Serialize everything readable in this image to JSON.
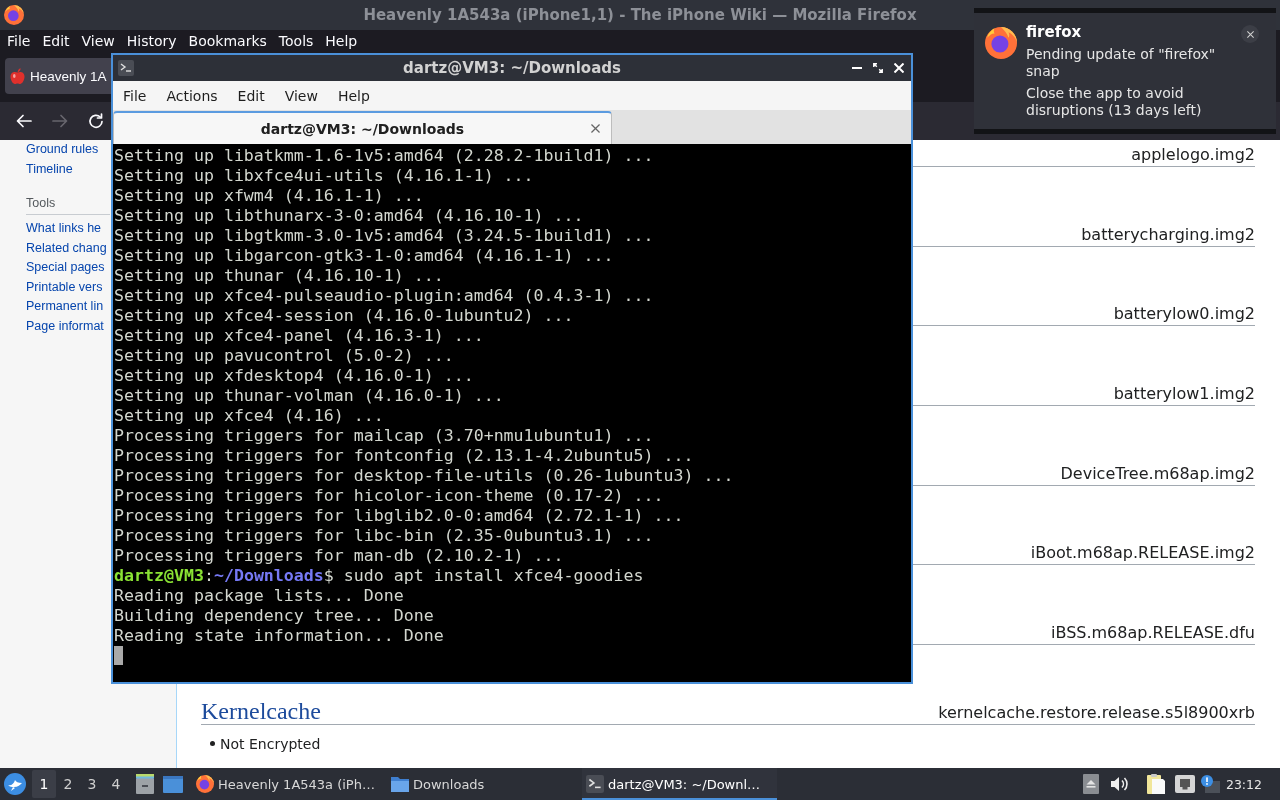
{
  "browser": {
    "title": "Heavenly 1A543a (iPhone1,1) - The iPhone Wiki — Mozilla Firefox",
    "menu": [
      "File",
      "Edit",
      "View",
      "History",
      "Bookmarks",
      "Tools",
      "Help"
    ],
    "tabs": [
      {
        "label": "Heavenly 1A",
        "selected": true
      }
    ],
    "nav_buttons": [
      {
        "kind": "back",
        "disabled": false
      },
      {
        "kind": "forward",
        "disabled": true
      },
      {
        "kind": "reload",
        "disabled": false
      }
    ],
    "sidebar": {
      "links": [
        "Ground rules",
        "Timeline"
      ],
      "portlets": [
        {
          "heading": "Tools",
          "links": [
            "What links he",
            "Related chang",
            "Special pages",
            "Printable vers",
            "Permanent lin",
            "Page informat"
          ]
        }
      ]
    },
    "sections": [
      {
        "file": "applelogo.img2"
      },
      {
        "file": "batterycharging.img2"
      },
      {
        "file": "batterylow0.img2"
      },
      {
        "file": "batterylow1.img2"
      },
      {
        "file": "DeviceTree.m68ap.img2"
      },
      {
        "file": "iBoot.m68ap.RELEASE.img2"
      },
      {
        "file": "iBSS.m68ap.RELEASE.dfu"
      },
      {
        "title": "Kernelcache",
        "file": "kernelcache.restore.release.s5l8900xrb",
        "bullets": [
          "Not Encrypted"
        ]
      }
    ]
  },
  "terminal": {
    "title": "dartz@VM3: ~/Downloads",
    "menu": [
      "File",
      "Actions",
      "Edit",
      "View",
      "Help"
    ],
    "tabs": [
      {
        "label": "dartz@VM3: ~/Downloads",
        "selected": true
      }
    ],
    "lines": [
      {
        "kind": "output",
        "text": "Setting up libatkmm-1.6-1v5:amd64 (2.28.2-1build1) ..."
      },
      {
        "kind": "output",
        "text": "Setting up libxfce4ui-utils (4.16.1-1) ..."
      },
      {
        "kind": "output",
        "text": "Setting up xfwm4 (4.16.1-1) ..."
      },
      {
        "kind": "output",
        "text": "Setting up libthunarx-3-0:amd64 (4.16.10-1) ..."
      },
      {
        "kind": "output",
        "text": "Setting up libgtkmm-3.0-1v5:amd64 (3.24.5-1build1) ..."
      },
      {
        "kind": "output",
        "text": "Setting up libgarcon-gtk3-1-0:amd64 (4.16.1-1) ..."
      },
      {
        "kind": "output",
        "text": "Setting up thunar (4.16.10-1) ..."
      },
      {
        "kind": "output",
        "text": "Setting up xfce4-pulseaudio-plugin:amd64 (0.4.3-1) ..."
      },
      {
        "kind": "output",
        "text": "Setting up xfce4-session (4.16.0-1ubuntu2) ..."
      },
      {
        "kind": "output",
        "text": "Setting up xfce4-panel (4.16.3-1) ..."
      },
      {
        "kind": "output",
        "text": "Setting up pavucontrol (5.0-2) ..."
      },
      {
        "kind": "output",
        "text": "Setting up xfdesktop4 (4.16.0-1) ..."
      },
      {
        "kind": "output",
        "text": "Setting up thunar-volman (4.16.0-1) ..."
      },
      {
        "kind": "output",
        "text": "Setting up xfce4 (4.16) ..."
      },
      {
        "kind": "output",
        "text": "Processing triggers for mailcap (3.70+nmu1ubuntu1) ..."
      },
      {
        "kind": "output",
        "text": "Processing triggers for fontconfig (2.13.1-4.2ubuntu5) ..."
      },
      {
        "kind": "output",
        "text": "Processing triggers for desktop-file-utils (0.26-1ubuntu3) ..."
      },
      {
        "kind": "output",
        "text": "Processing triggers for hicolor-icon-theme (0.17-2) ..."
      },
      {
        "kind": "output",
        "text": "Processing triggers for libglib2.0-0:amd64 (2.72.1-1) ..."
      },
      {
        "kind": "output",
        "text": "Processing triggers for libc-bin (2.35-0ubuntu3.1) ..."
      },
      {
        "kind": "output",
        "text": "Processing triggers for man-db (2.10.2-1) ..."
      },
      {
        "kind": "prompt",
        "user_host": "dartz@VM3",
        "separator": ":",
        "path": "~/Downloads",
        "symbol": "$",
        "command": "sudo apt install xfce4-goodies"
      },
      {
        "kind": "output",
        "text": "Reading package lists... Done"
      },
      {
        "kind": "output",
        "text": "Building dependency tree... Done"
      },
      {
        "kind": "output",
        "text": "Reading state information... Done"
      }
    ],
    "cursor": true
  },
  "notification": {
    "app": "firefox",
    "paragraphs": [
      "Pending update of \"firefox\" snap",
      "Close the app to avoid disruptions (13 days left)"
    ]
  },
  "taskbar": {
    "workspaces": [
      {
        "label": "1",
        "selected": true
      },
      {
        "label": "2",
        "selected": false
      },
      {
        "label": "3",
        "selected": false
      },
      {
        "label": "4",
        "selected": false
      }
    ],
    "tasks": [
      {
        "kind": "browser",
        "label": "Heavenly 1A543a (iPh…",
        "selected": false
      },
      {
        "kind": "folder",
        "label": "Downloads",
        "selected": false
      },
      {
        "kind": "terminal",
        "label": "dartz@VM3: ~/Downl…",
        "selected": true
      }
    ],
    "clock": "23:12"
  }
}
